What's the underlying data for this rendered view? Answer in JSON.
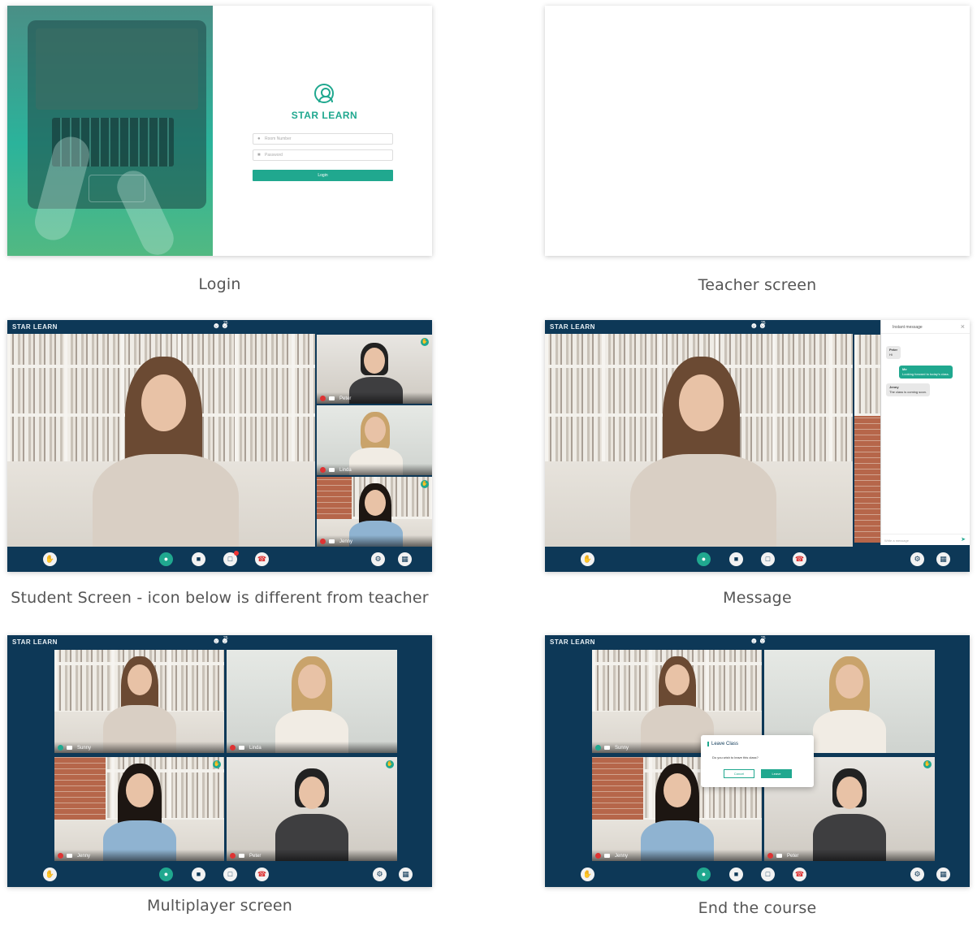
{
  "captions": {
    "login": "Login",
    "teacher": "Teacher screen",
    "student": "Student Screen - icon below is different from teacher",
    "message": "Message",
    "multiplayer": "Multiplayer screen",
    "end": "End the course"
  },
  "login_screen": {
    "brand": "STAR LEARN",
    "room_placeholder": "Room Number",
    "password_placeholder": "Password",
    "login_label": "Login"
  },
  "classroom": {
    "brand": "STAR LEARN",
    "participant_count": "25",
    "participants": {
      "peter": "Peter",
      "linda": "Linda",
      "jenny": "Jenny",
      "sunny": "Sunny"
    }
  },
  "chat": {
    "title": "Instant message",
    "messages": [
      {
        "sender": "Peter",
        "text": "Hi",
        "own": false
      },
      {
        "sender": "Me",
        "text": "Looking forward to today's class.",
        "own": true
      },
      {
        "sender": "Jenny",
        "text": "The class is coming soon.",
        "own": false
      }
    ],
    "input_placeholder": "Write a message"
  },
  "leave_dialog": {
    "title": "Leave Class",
    "question": "Do you wish to leave this class?",
    "cancel": "Cancel",
    "leave": "Leave"
  },
  "colors": {
    "brand_teal": "#20a88f",
    "navy": "#0d3857"
  },
  "icons": [
    "raise-hand-icon",
    "microphone-icon",
    "camera-icon",
    "chat-icon",
    "hang-up-icon",
    "settings-icon",
    "layout-grid-icon",
    "participants-icon",
    "user-icon",
    "lock-icon",
    "send-icon",
    "close-icon"
  ]
}
